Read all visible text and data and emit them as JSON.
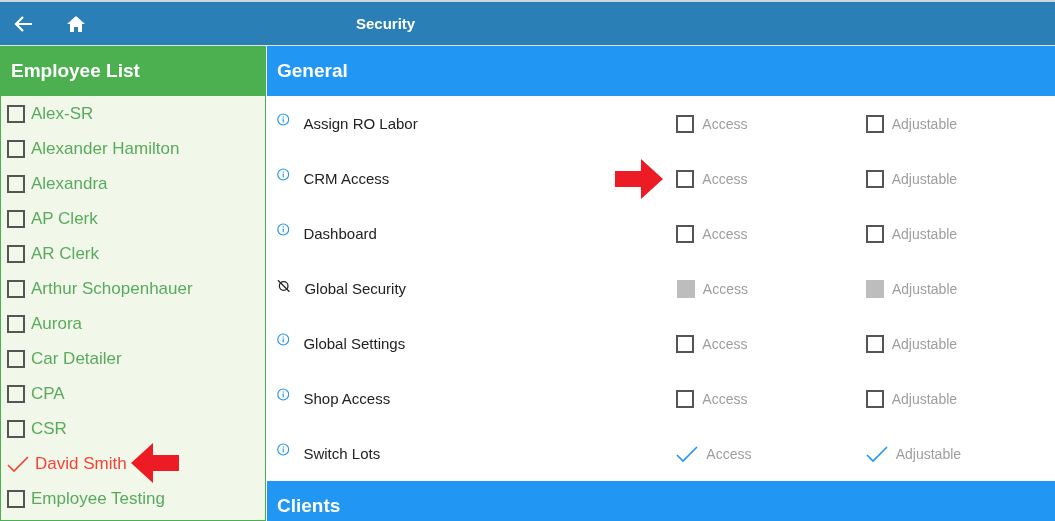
{
  "top_bar": {
    "title": "Security"
  },
  "employee_list": {
    "title": "Employee List",
    "items": [
      {
        "name": "Alex-SR",
        "checked": false,
        "marked": false
      },
      {
        "name": "Alexander Hamilton",
        "checked": false,
        "marked": false
      },
      {
        "name": "Alexandra",
        "checked": false,
        "marked": false
      },
      {
        "name": "AP Clerk",
        "checked": false,
        "marked": false
      },
      {
        "name": "AR Clerk",
        "checked": false,
        "marked": false
      },
      {
        "name": "Arthur Schopenhauer",
        "checked": false,
        "marked": false
      },
      {
        "name": "Aurora",
        "checked": false,
        "marked": false
      },
      {
        "name": "Car Detailer",
        "checked": false,
        "marked": false
      },
      {
        "name": "CPA",
        "checked": false,
        "marked": false
      },
      {
        "name": "CSR",
        "checked": false,
        "marked": false
      },
      {
        "name": "David Smith",
        "checked": true,
        "marked": true
      },
      {
        "name": "Employee Testing",
        "checked": false,
        "marked": false
      }
    ]
  },
  "sections": [
    {
      "title": "General",
      "rows": [
        {
          "label": "Assign RO Labor",
          "kind": "info",
          "marked": false,
          "access": {
            "label": "Access",
            "checked": false,
            "disabled": false
          },
          "adjustable": {
            "label": "Adjustable",
            "checked": false,
            "disabled": false
          }
        },
        {
          "label": "CRM Access",
          "kind": "info",
          "marked": true,
          "access": {
            "label": "Access",
            "checked": false,
            "disabled": false
          },
          "adjustable": {
            "label": "Adjustable",
            "checked": false,
            "disabled": false
          }
        },
        {
          "label": "Dashboard",
          "kind": "info",
          "marked": false,
          "access": {
            "label": "Access",
            "checked": false,
            "disabled": false
          },
          "adjustable": {
            "label": "Adjustable",
            "checked": false,
            "disabled": false
          }
        },
        {
          "label": "Global Security",
          "kind": "blocked",
          "marked": false,
          "access": {
            "label": "Access",
            "checked": false,
            "disabled": true
          },
          "adjustable": {
            "label": "Adjustable",
            "checked": false,
            "disabled": true
          }
        },
        {
          "label": "Global Settings",
          "kind": "info",
          "marked": false,
          "access": {
            "label": "Access",
            "checked": false,
            "disabled": false
          },
          "adjustable": {
            "label": "Adjustable",
            "checked": false,
            "disabled": false
          }
        },
        {
          "label": "Shop Access",
          "kind": "info",
          "marked": false,
          "access": {
            "label": "Access",
            "checked": false,
            "disabled": false
          },
          "adjustable": {
            "label": "Adjustable",
            "checked": false,
            "disabled": false
          }
        },
        {
          "label": "Switch Lots",
          "kind": "info",
          "marked": false,
          "access": {
            "label": "Access",
            "checked": true,
            "disabled": false
          },
          "adjustable": {
            "label": "Adjustable",
            "checked": true,
            "disabled": false
          }
        }
      ]
    },
    {
      "title": "Clients"
    }
  ]
}
